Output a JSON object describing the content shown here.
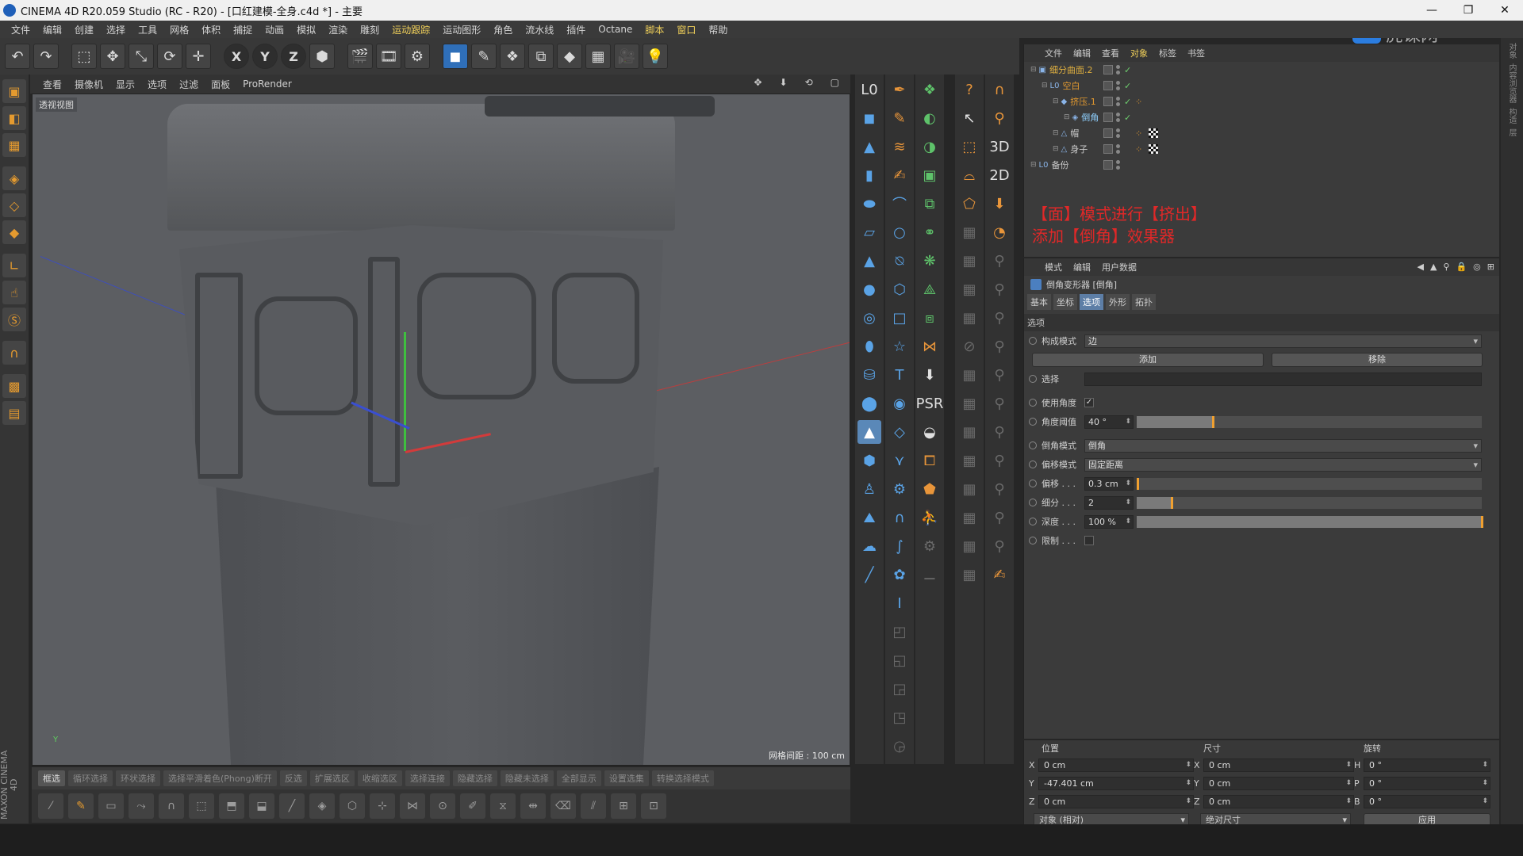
{
  "window": {
    "title": "CINEMA 4D R20.059 Studio (RC - R20) - [口红建模-全身.c4d *] - 主要",
    "controls": [
      "—",
      "❐",
      "✕"
    ]
  },
  "watermark": {
    "text": "虎课网"
  },
  "menubar": {
    "items": [
      "文件",
      "编辑",
      "创建",
      "选择",
      "工具",
      "网格",
      "体积",
      "捕捉",
      "动画",
      "模拟",
      "渲染",
      "雕刻",
      "运动跟踪",
      "运动图形",
      "角色",
      "流水线",
      "插件",
      "Octane",
      "脚本",
      "窗口",
      "帮助"
    ]
  },
  "toolbar": {
    "buttons": [
      {
        "name": "undo-icon",
        "glyph": "↶"
      },
      {
        "name": "redo-icon",
        "glyph": "↷"
      },
      {
        "name": "live-select-icon",
        "glyph": "⬚"
      },
      {
        "name": "move-icon",
        "glyph": "✥"
      },
      {
        "name": "scale-icon",
        "glyph": "⤡"
      },
      {
        "name": "rotate-icon",
        "glyph": "⟳"
      },
      {
        "name": "recent-tool-icon",
        "glyph": "✛"
      },
      {
        "name": "x-axis-icon",
        "glyph": "X"
      },
      {
        "name": "y-axis-icon",
        "glyph": "Y"
      },
      {
        "name": "z-axis-icon",
        "glyph": "Z"
      },
      {
        "name": "coord-system-icon",
        "glyph": "⬢"
      },
      {
        "name": "render-view-icon",
        "glyph": "🎬"
      },
      {
        "name": "render-picture-viewer-icon",
        "glyph": "🎞"
      },
      {
        "name": "render-settings-icon",
        "glyph": "⚙"
      },
      {
        "name": "cube-icon",
        "glyph": "◼"
      },
      {
        "name": "pen-icon",
        "glyph": "✎"
      },
      {
        "name": "subdivision-icon",
        "glyph": "❖"
      },
      {
        "name": "array-icon",
        "glyph": "⧉"
      },
      {
        "name": "deformer-icon",
        "glyph": "◆"
      },
      {
        "name": "floor-icon",
        "glyph": "▦"
      },
      {
        "name": "camera-icon",
        "glyph": "🎥"
      },
      {
        "name": "light-icon",
        "glyph": "💡"
      }
    ]
  },
  "viewport": {
    "menu": [
      "查看",
      "摄像机",
      "显示",
      "选项",
      "过滤",
      "面板",
      "ProRender"
    ],
    "label": "透视视图",
    "grid_info": "网格间距 : 100 cm",
    "axis_mini": "Y"
  },
  "selection_bar": {
    "items": [
      "框选",
      "循环选择",
      "环状选择",
      "选择平滑着色(Phong)断开",
      "反选",
      "扩展选区",
      "收缩选区",
      "选择连接",
      "隐藏选择",
      "隐藏未选择",
      "全部显示",
      "设置选集",
      "转换选择模式"
    ]
  },
  "maxon": {
    "text": "MAXON CINEMA 4D"
  },
  "object_manager": {
    "tabs": [
      "文件",
      "编辑",
      "查看",
      "对象",
      "标签",
      "书签"
    ],
    "rows": [
      {
        "name": "细分曲面.2",
        "indent": 0,
        "color": "yellow",
        "icon": "▣"
      },
      {
        "name": "空白",
        "indent": 1,
        "color": "orange",
        "icon": "L0"
      },
      {
        "name": "挤压.1",
        "indent": 2,
        "color": "orange",
        "icon": "◆"
      },
      {
        "name": "倒角",
        "indent": 3,
        "color": "cyan",
        "icon": "◈"
      },
      {
        "name": "帽",
        "indent": 2,
        "color": "plain",
        "icon": "△"
      },
      {
        "name": "身子",
        "indent": 2,
        "color": "plain",
        "icon": "△"
      },
      {
        "name": "备份",
        "indent": 0,
        "color": "plain",
        "icon": "L0"
      }
    ],
    "annotation": [
      "【面】模式进行【挤出】",
      "添加【倒角】效果器"
    ]
  },
  "attribute_manager": {
    "tabs": [
      "模式",
      "编辑",
      "用户数据"
    ],
    "object_title": "倒角变形器 [倒角]",
    "subtabs": [
      "基本",
      "坐标",
      "选项",
      "外形",
      "拓扑"
    ],
    "active_subtab": "选项",
    "section": "选项",
    "fields": {
      "component_mode": {
        "label": "构成模式",
        "value": "边"
      },
      "add_button": "添加",
      "remove_button": "移除",
      "selection": {
        "label": "选择",
        "value": ""
      },
      "use_angle": {
        "label": "使用角度",
        "checked": "✓"
      },
      "angle_threshold": {
        "label": "角度阈值",
        "value": "40 °",
        "fraction": 0.22
      },
      "bevel_mode": {
        "label": "倒角模式",
        "value": "倒角"
      },
      "offset_mode": {
        "label": "偏移模式",
        "value": "固定距离"
      },
      "offset": {
        "label": "偏移 . . .",
        "value": "0.3 cm",
        "fraction": 0.003
      },
      "subdivision": {
        "label": "细分 . . .",
        "value": "2",
        "fraction": 0.1
      },
      "depth": {
        "label": "深度 . . .",
        "value": "100 %",
        "fraction": 1.0
      },
      "limit": {
        "label": "限制 . . .",
        "checked": ""
      }
    }
  },
  "coordinates": {
    "headers": [
      "位置",
      "尺寸",
      "旋转"
    ],
    "rows": [
      {
        "pos_axis": "X",
        "pos": "0 cm",
        "size_axis": "X",
        "size": "0 cm",
        "rot_axis": "H",
        "rot": "0 °"
      },
      {
        "pos_axis": "Y",
        "pos": "-47.401 cm",
        "size_axis": "Y",
        "size": "0 cm",
        "rot_axis": "P",
        "rot": "0 °"
      },
      {
        "pos_axis": "Z",
        "pos": "0 cm",
        "size_axis": "Z",
        "size": "0 cm",
        "rot_axis": "B",
        "rot": "0 °"
      }
    ],
    "mode1": "对象 (相对)",
    "mode2": "绝对尺寸",
    "apply": "应用"
  },
  "right_edge": [
    "对象",
    "内容浏览器",
    "构造",
    "层"
  ],
  "colors": {
    "accent": "#f0a030",
    "highlight_menu": "#f3d25a",
    "annotation": "#e02828",
    "active_tab": "#5d7ea6"
  }
}
